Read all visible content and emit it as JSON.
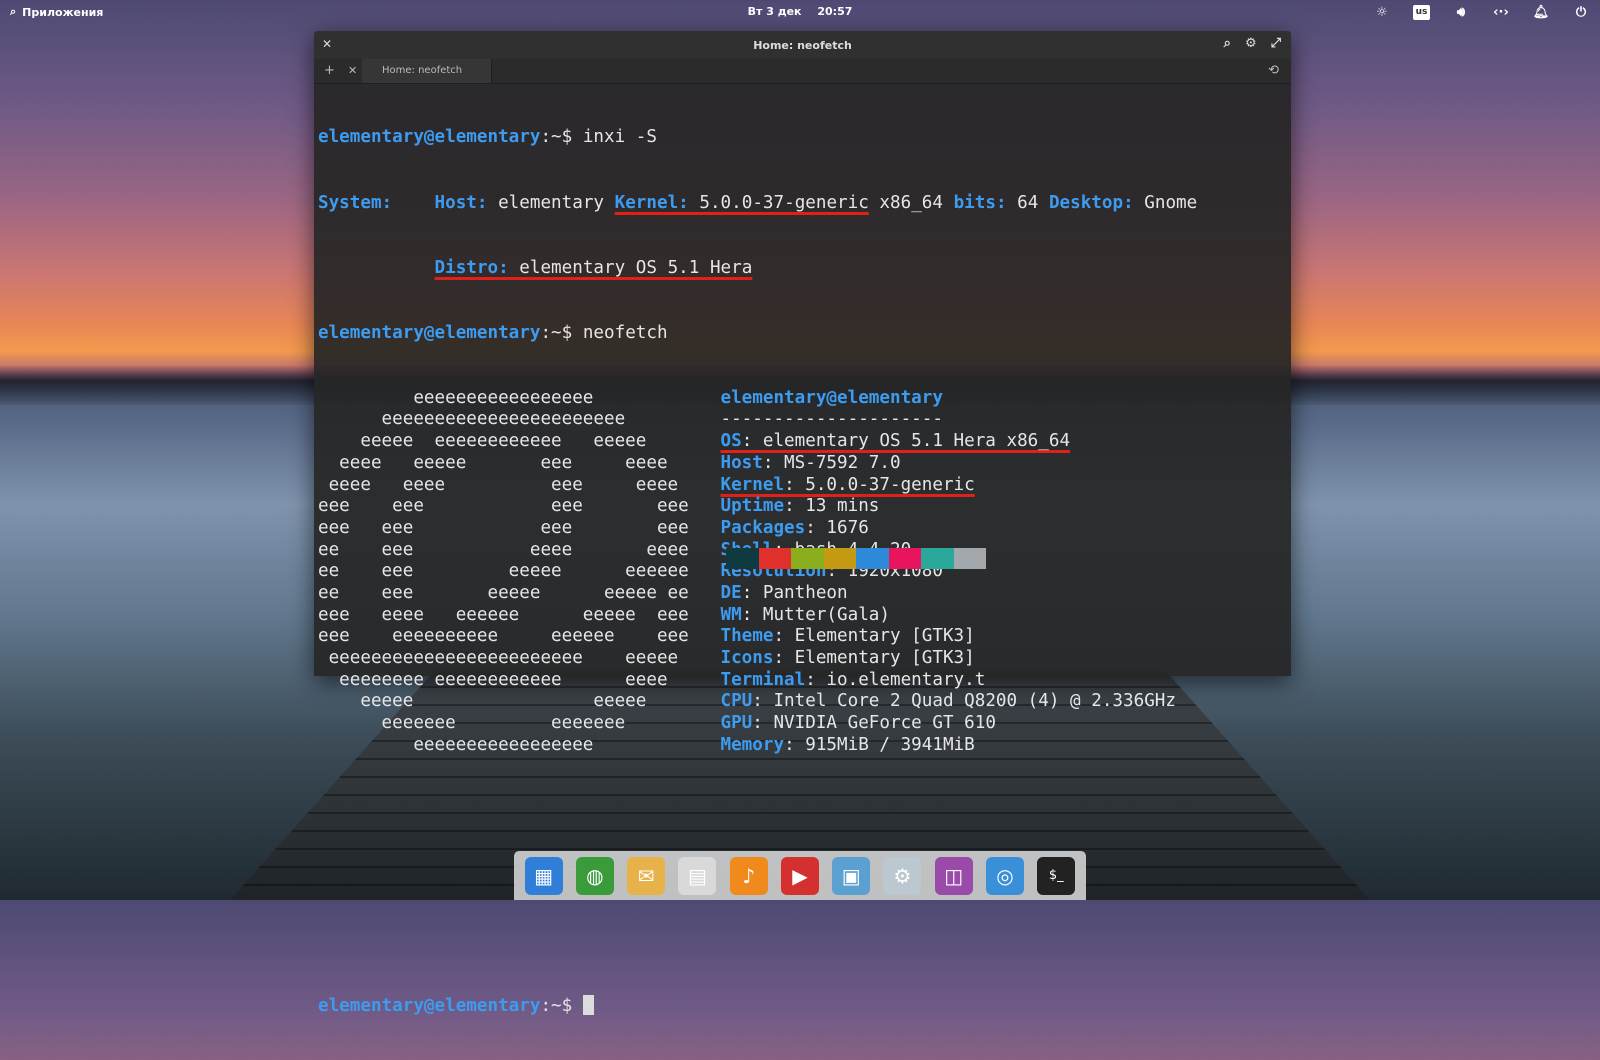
{
  "panel": {
    "apps_label": "Приложения",
    "date": "Вт 3 дек",
    "time": "20:57",
    "keyboard_layout": "us"
  },
  "window": {
    "title": "Home: neofetch",
    "tab_label": "Home: neofetch"
  },
  "terminal": {
    "prompt_user": "elementary@elementary",
    "prompt_path": ":~$",
    "cmd1": " inxi -S",
    "cmd2": " neofetch",
    "inxi": {
      "system_label": "System:",
      "host_label": "Host:",
      "host_value": " elementary ",
      "kernel_label": "Kernel:",
      "kernel_value": " 5.0.0-37-generic",
      "arch": " x86_64 ",
      "bits_label": "bits:",
      "bits_value": " 64 ",
      "desktop_label": "Desktop:",
      "desktop_value": " Gnome",
      "distro_label": "Distro:",
      "distro_value": " elementary OS 5.1 Hera"
    },
    "ascii": [
      "         eeeeeeeeeeeeeeeee         ",
      "      eeeeeeeeeeeeeeeeeeeeeee      ",
      "    eeeee  eeeeeeeeeeee   eeeee    ",
      "  eeee   eeeee       eee     eeee  ",
      " eeee   eeee          eee     eeee ",
      "eee    eee            eee       eee",
      "eee   eee            eee        eee",
      "ee    eee           eeee       eeee",
      "ee    eee         eeeee      eeeeee",
      "ee    eee       eeeee      eeeee ee",
      "eee   eeee   eeeeee      eeeee  eee",
      "eee    eeeeeeeeee     eeeeee    eee",
      " eeeeeeeeeeeeeeeeeeeeeeee    eeeee ",
      "  eeeeeeee eeeeeeeeeeee      eeee  ",
      "    eeeee                 eeeee    ",
      "      eeeeeee         eeeeeee      ",
      "         eeeeeeeeeeeeeeeee         "
    ],
    "neofetch": {
      "header": "elementary@elementary",
      "separator": "---------------------",
      "rows": [
        {
          "key": "OS",
          "value": ": elementary OS 5.1 Hera x86_64"
        },
        {
          "key": "Host",
          "value": ": MS-7592 7.0"
        },
        {
          "key": "Kernel",
          "value": ": 5.0.0-37-generic"
        },
        {
          "key": "Uptime",
          "value": ": 13 mins"
        },
        {
          "key": "Packages",
          "value": ": 1676"
        },
        {
          "key": "Shell",
          "value": ": bash 4.4.20"
        },
        {
          "key": "Resolution",
          "value": ": 1920x1080"
        },
        {
          "key": "DE",
          "value": ": Pantheon"
        },
        {
          "key": "WM",
          "value": ": Mutter(Gala)"
        },
        {
          "key": "Theme",
          "value": ": Elementary [GTK3]"
        },
        {
          "key": "Icons",
          "value": ": Elementary [GTK3]"
        },
        {
          "key": "Terminal",
          "value": ": io.elementary.t"
        },
        {
          "key": "CPU",
          "value": ": Intel Core 2 Quad Q8200 (4) @ 2.336GHz"
        },
        {
          "key": "GPU",
          "value": ": NVIDIA GeForce GT 610"
        },
        {
          "key": "Memory",
          "value": ": 915MiB / 3941MiB"
        }
      ]
    },
    "palette": [
      "#0f3a40",
      "#e0302c",
      "#8bae1c",
      "#c49a12",
      "#2d8ad8",
      "#e8155e",
      "#2aa89a",
      "#a2a8ab"
    ]
  },
  "dock": {
    "items": [
      {
        "name": "multitasking-view",
        "color": "#2f7fd8",
        "glyph": "▦"
      },
      {
        "name": "epiphany-browser",
        "color": "#3a9b3a",
        "glyph": "◍"
      },
      {
        "name": "mail",
        "color": "#e8b24a",
        "glyph": "✉"
      },
      {
        "name": "calendar",
        "color": "#d9d9d9",
        "glyph": "▤"
      },
      {
        "name": "music",
        "color": "#f08a1c",
        "glyph": "♪"
      },
      {
        "name": "videos",
        "color": "#d43030",
        "glyph": "▶"
      },
      {
        "name": "photos",
        "color": "#5aa0d0",
        "glyph": "▣"
      },
      {
        "name": "system-settings",
        "color": "#bcc8d0",
        "glyph": "⚙"
      },
      {
        "name": "appcenter",
        "color": "#9a4aa8",
        "glyph": "◫"
      },
      {
        "name": "installer",
        "color": "#3a90d8",
        "glyph": "◎"
      },
      {
        "name": "terminal",
        "color": "#222222",
        "glyph": "$_"
      }
    ]
  }
}
